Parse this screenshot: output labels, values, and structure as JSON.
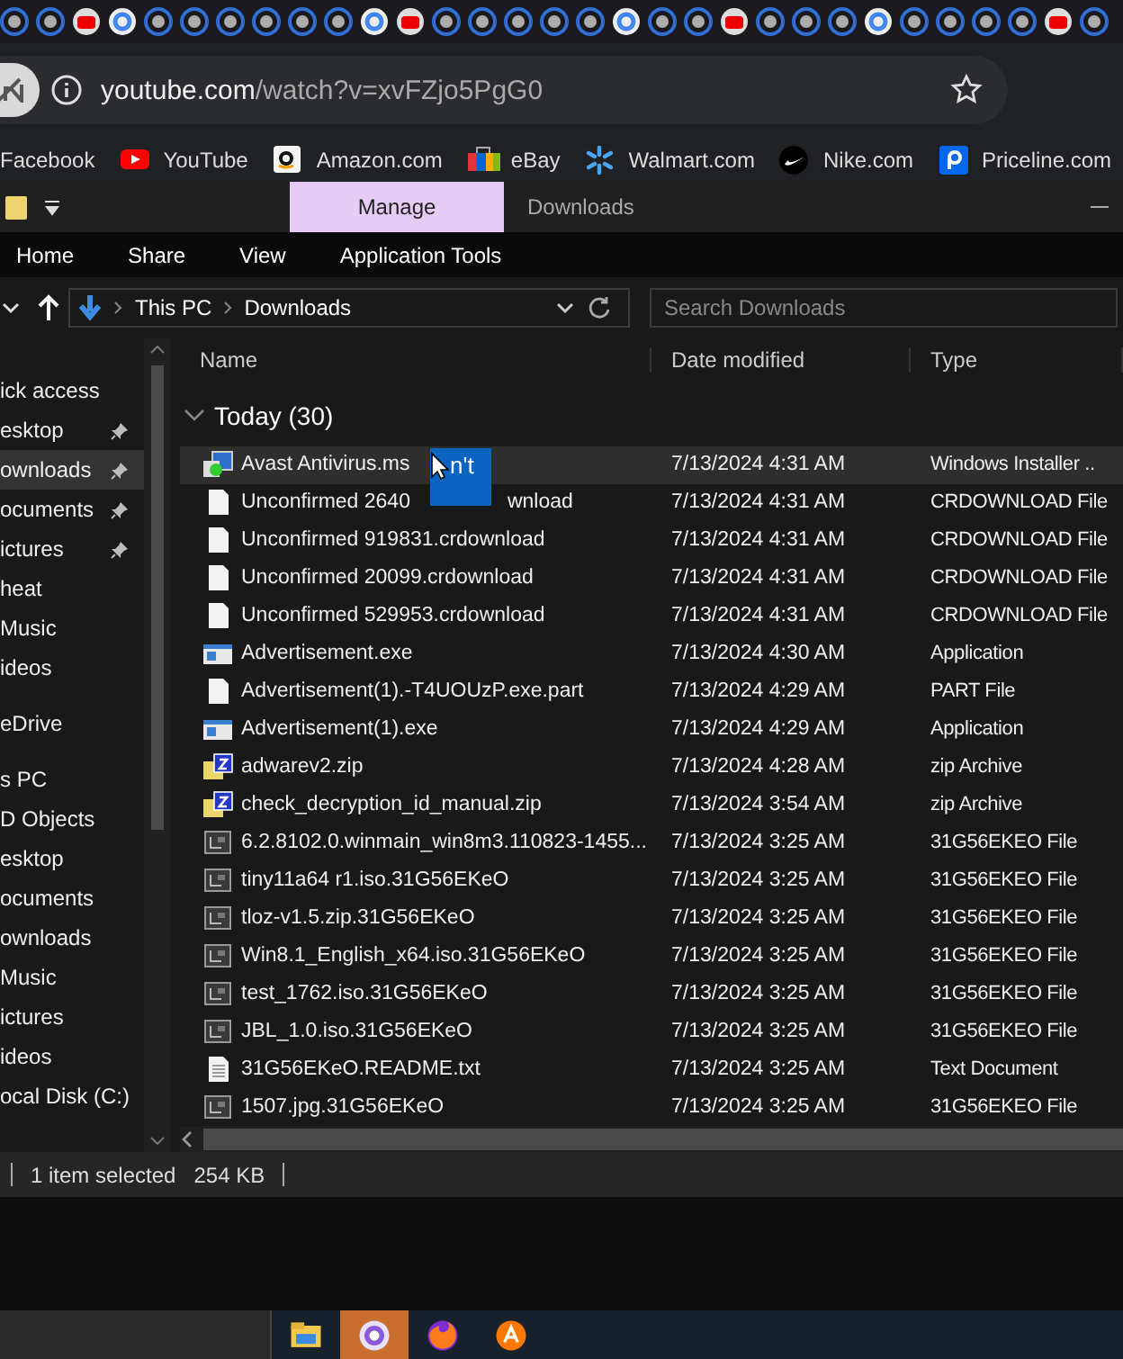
{
  "browser": {
    "url_host": "youtube.com",
    "url_path": "/watch?v=xvFZjo5PgG0",
    "bookmarks": [
      {
        "label": "Facebook",
        "kind": "none"
      },
      {
        "label": "YouTube",
        "kind": "youtube"
      },
      {
        "label": "Amazon.com",
        "kind": "amazon"
      },
      {
        "label": "eBay",
        "kind": "ebay"
      },
      {
        "label": "Walmart.com",
        "kind": "walmart"
      },
      {
        "label": "Nike.com",
        "kind": "nike"
      },
      {
        "label": "Priceline.com",
        "kind": "priceline"
      }
    ]
  },
  "explorer": {
    "context_tab": {
      "label": "Manage",
      "selected": true
    },
    "window_title": "Downloads",
    "ribbon_tabs": [
      "Home",
      "Share",
      "View",
      "Application Tools"
    ],
    "breadcrumb": [
      "This PC",
      "Downloads"
    ],
    "search": {
      "placeholder": "Search Downloads"
    },
    "nav_sections": [
      {
        "items": [
          {
            "label": "ick access",
            "pinned": false,
            "selected": false
          },
          {
            "label": "esktop",
            "pinned": true,
            "selected": false
          },
          {
            "label": "ownloads",
            "pinned": true,
            "selected": true
          },
          {
            "label": "ocuments",
            "pinned": true,
            "selected": false
          },
          {
            "label": "ictures",
            "pinned": true,
            "selected": false
          },
          {
            "label": "heat",
            "pinned": false,
            "selected": false
          },
          {
            "label": "Music",
            "pinned": false,
            "selected": false
          },
          {
            "label": "ideos",
            "pinned": false,
            "selected": false
          }
        ]
      },
      {
        "items": [
          {
            "label": "eDrive",
            "pinned": false,
            "selected": false
          }
        ]
      },
      {
        "items": [
          {
            "label": "s PC",
            "pinned": false,
            "selected": false
          },
          {
            "label": "D Objects",
            "pinned": false,
            "selected": false
          },
          {
            "label": "esktop",
            "pinned": false,
            "selected": false
          },
          {
            "label": "ocuments",
            "pinned": false,
            "selected": false
          },
          {
            "label": "ownloads",
            "pinned": false,
            "selected": false
          },
          {
            "label": "Music",
            "pinned": false,
            "selected": false
          },
          {
            "label": "ictures",
            "pinned": false,
            "selected": false
          },
          {
            "label": "ideos",
            "pinned": false,
            "selected": false
          },
          {
            "label": "ocal Disk (C:)",
            "pinned": false,
            "selected": false
          }
        ]
      }
    ],
    "columns": [
      "Name",
      "Date modified",
      "Type"
    ],
    "group": {
      "label": "Today (30)",
      "expanded": true
    },
    "overlay_text": "n't",
    "files": [
      {
        "name": "Avast Antivirus.ms",
        "kind": "msi",
        "date": "7/13/2024 4:31 AM",
        "type": "Windows Installer ..",
        "selected": true
      },
      {
        "name": "Unconfirmed 2640",
        "name_tail": "wnload",
        "kind": "blank",
        "date": "7/13/2024 4:31 AM",
        "type": "CRDOWNLOAD File",
        "selected": false
      },
      {
        "name": "Unconfirmed 919831.crdownload",
        "kind": "blank",
        "date": "7/13/2024 4:31 AM",
        "type": "CRDOWNLOAD File",
        "selected": false
      },
      {
        "name": "Unconfirmed 20099.crdownload",
        "kind": "blank",
        "date": "7/13/2024 4:31 AM",
        "type": "CRDOWNLOAD File",
        "selected": false
      },
      {
        "name": "Unconfirmed 529953.crdownload",
        "kind": "blank",
        "date": "7/13/2024 4:31 AM",
        "type": "CRDOWNLOAD File",
        "selected": false
      },
      {
        "name": "Advertisement.exe",
        "kind": "exe",
        "date": "7/13/2024 4:30 AM",
        "type": "Application",
        "selected": false
      },
      {
        "name": "Advertisement(1).-T4UOUzP.exe.part",
        "kind": "blank",
        "date": "7/13/2024 4:29 AM",
        "type": "PART File",
        "selected": false
      },
      {
        "name": "Advertisement(1).exe",
        "kind": "exe",
        "date": "7/13/2024 4:29 AM",
        "type": "Application",
        "selected": false
      },
      {
        "name": "adwarev2.zip",
        "kind": "zip",
        "date": "7/13/2024 4:28 AM",
        "type": "zip Archive",
        "selected": false
      },
      {
        "name": "check_decryption_id_manual.zip",
        "kind": "zip",
        "date": "7/13/2024 3:54 AM",
        "type": "zip Archive",
        "selected": false
      },
      {
        "name": "6.2.8102.0.winmain_win8m3.110823-1455...",
        "kind": "encrypted",
        "date": "7/13/2024 3:25 AM",
        "type": "31G56EKEO File",
        "selected": false
      },
      {
        "name": "tiny11a64 r1.iso.31G56EKeO",
        "kind": "encrypted",
        "date": "7/13/2024 3:25 AM",
        "type": "31G56EKEO File",
        "selected": false
      },
      {
        "name": "tloz-v1.5.zip.31G56EKeO",
        "kind": "encrypted",
        "date": "7/13/2024 3:25 AM",
        "type": "31G56EKEO File",
        "selected": false
      },
      {
        "name": "Win8.1_English_x64.iso.31G56EKeO",
        "kind": "encrypted",
        "date": "7/13/2024 3:25 AM",
        "type": "31G56EKEO File",
        "selected": false
      },
      {
        "name": "test_1762.iso.31G56EKeO",
        "kind": "encrypted",
        "date": "7/13/2024 3:25 AM",
        "type": "31G56EKEO File",
        "selected": false
      },
      {
        "name": "JBL_1.0.iso.31G56EKeO",
        "kind": "encrypted",
        "date": "7/13/2024 3:25 AM",
        "type": "31G56EKEO File",
        "selected": false
      },
      {
        "name": "31G56EKeO.README.txt",
        "kind": "txt",
        "date": "7/13/2024 3:25 AM",
        "type": "Text Document",
        "selected": false
      },
      {
        "name": "1507.jpg.31G56EKeO",
        "kind": "encrypted",
        "date": "7/13/2024 3:25 AM",
        "type": "31G56EKEO File",
        "selected": false
      }
    ],
    "status": {
      "selection": "1 item selected",
      "size": "254 KB"
    }
  },
  "taskbar": [
    {
      "kind": "explorer",
      "active": false
    },
    {
      "kind": "shield",
      "active": true
    },
    {
      "kind": "firefox",
      "active": false
    },
    {
      "kind": "avast",
      "active": false
    }
  ]
}
